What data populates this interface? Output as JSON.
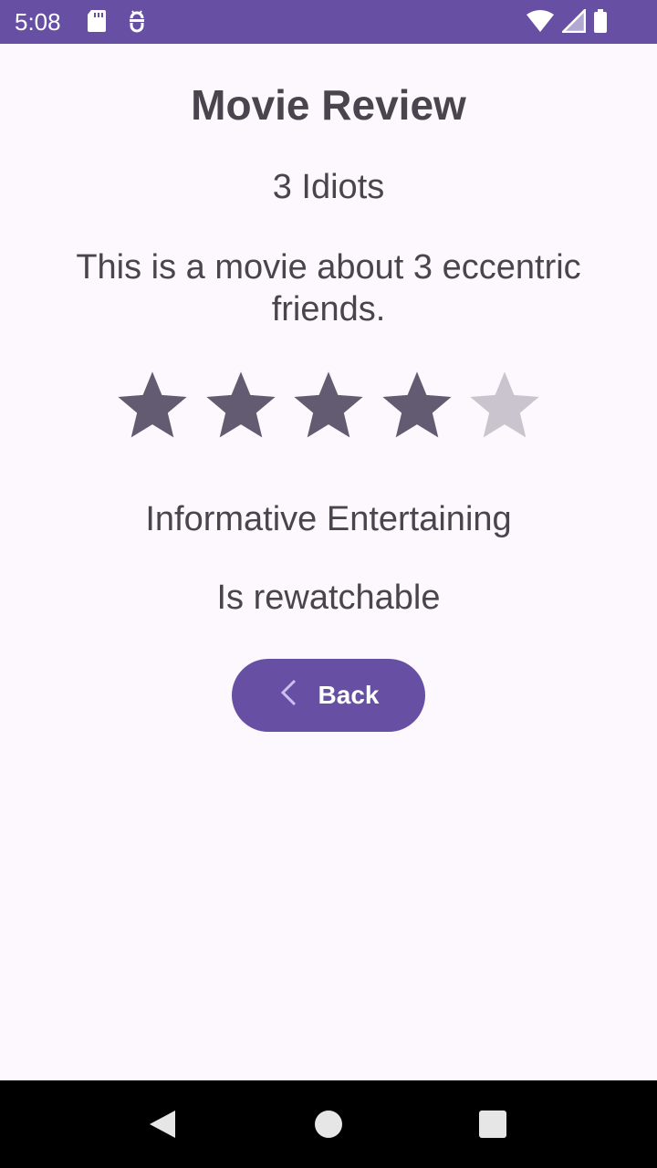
{
  "status_bar": {
    "time": "5:08",
    "left_icons": [
      "sd-card-icon",
      "debug-icon"
    ],
    "right_icons": [
      "wifi-icon",
      "signal-icon",
      "battery-icon"
    ]
  },
  "review": {
    "title": "Movie Review",
    "movie_name": "3 Idiots",
    "description": "This is a movie about 3 eccentric friends.",
    "rating": 4,
    "rating_max": 5,
    "tags": "Informative Entertaining",
    "rewatchable": "Is rewatchable"
  },
  "back_button": {
    "icon": "chevron-left-icon",
    "label": "Back"
  },
  "nav_bar": {
    "buttons": [
      "back-triangle-icon",
      "home-circle-icon",
      "recents-square-icon"
    ]
  },
  "colors": {
    "primary": "#6750a4",
    "star_filled": "#625b71",
    "star_empty": "#cac4cf",
    "background": "#fdf8fd",
    "text": "#49454f"
  }
}
